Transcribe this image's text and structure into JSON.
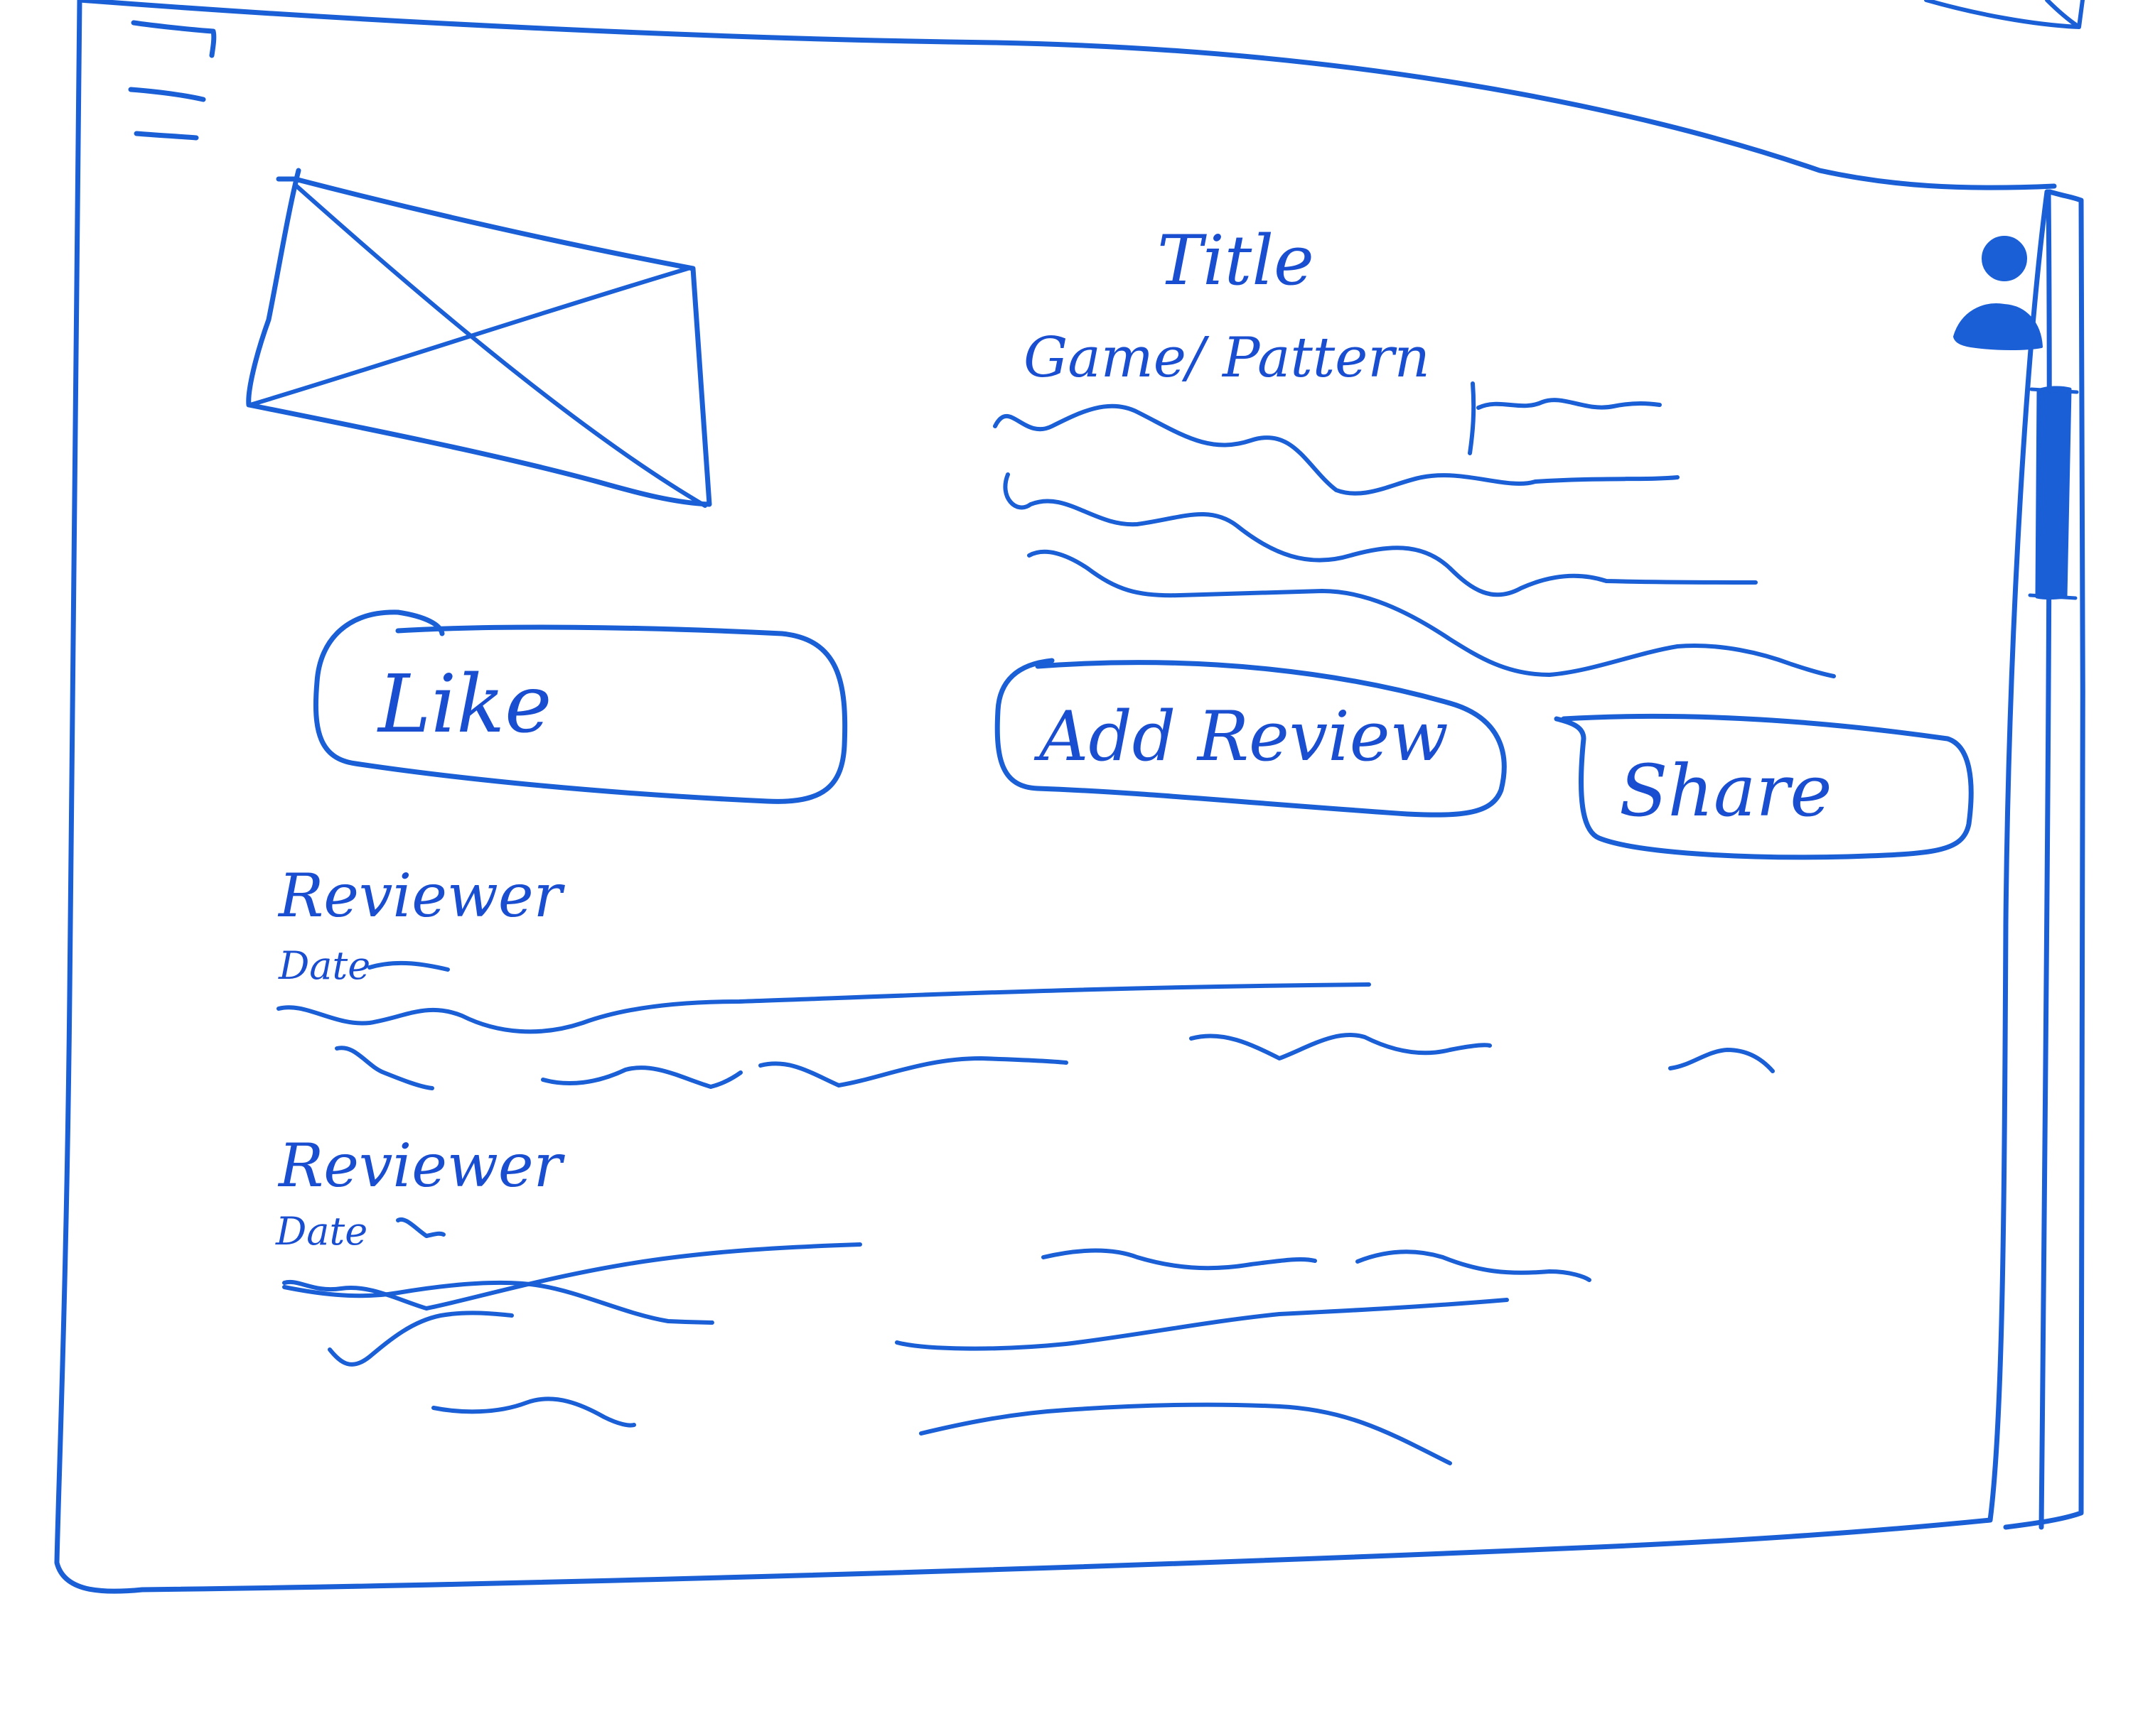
{
  "header": {
    "menu_icon": "hamburger-menu-icon"
  },
  "game": {
    "image_icon": "image-placeholder-icon",
    "title": "Title",
    "subtitle": "Game/ Pattern"
  },
  "actions": {
    "like_label": "Like",
    "add_review_label": "Add Review",
    "share_label": "Share"
  },
  "account": {
    "avatar_icon": "user-avatar-icon"
  },
  "reviews": [
    {
      "reviewer": "Reviewer",
      "date": "Date"
    },
    {
      "reviewer": "Reviewer",
      "date": "Date"
    }
  ],
  "colors": {
    "ink": "#1a5fd6",
    "background": "#ffffff"
  }
}
